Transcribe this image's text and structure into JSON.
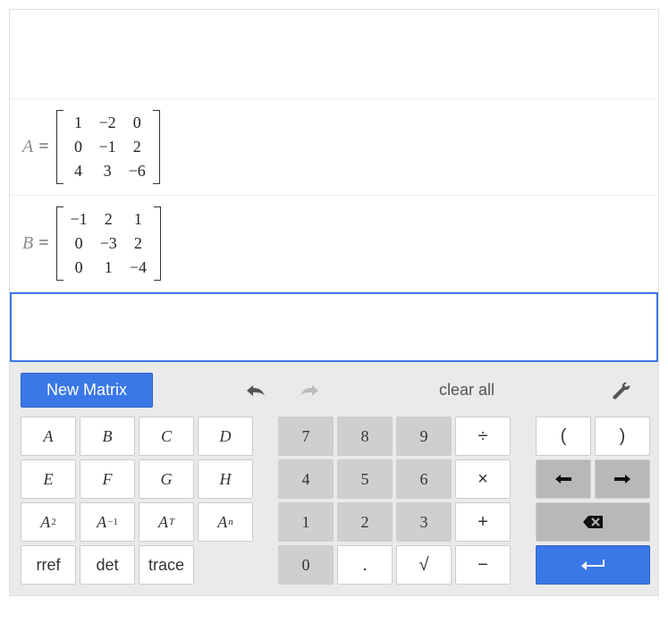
{
  "matrices": [
    {
      "name": "A",
      "values": [
        "1",
        "−2",
        "0",
        "0",
        "−1",
        "2",
        "4",
        "3",
        "−6"
      ]
    },
    {
      "name": "B",
      "values": [
        "−1",
        "2",
        "1",
        "0",
        "−3",
        "2",
        "0",
        "1",
        "−4"
      ]
    }
  ],
  "toolbar": {
    "new_matrix": "New Matrix",
    "clear_all": "clear all"
  },
  "keys": {
    "vars": [
      "A",
      "B",
      "C",
      "D",
      "E",
      "F",
      "G",
      "H"
    ],
    "pow2_base": "A",
    "pow2_sup": "2",
    "inv_base": "A",
    "inv_sup": "−1",
    "trans_base": "A",
    "trans_sup": "T",
    "pown_base": "A",
    "pown_sup": "n",
    "rref": "rref",
    "det": "det",
    "trace": "trace",
    "n7": "7",
    "n8": "8",
    "n9": "9",
    "div": "÷",
    "n4": "4",
    "n5": "5",
    "n6": "6",
    "mul": "×",
    "n1": "1",
    "n2": "2",
    "n3": "3",
    "add": "+",
    "n0": "0",
    "dot": ".",
    "sqrt": "√",
    "sub": "−",
    "lparen": "(",
    "rparen": ")",
    "left": "←",
    "right": "→"
  }
}
